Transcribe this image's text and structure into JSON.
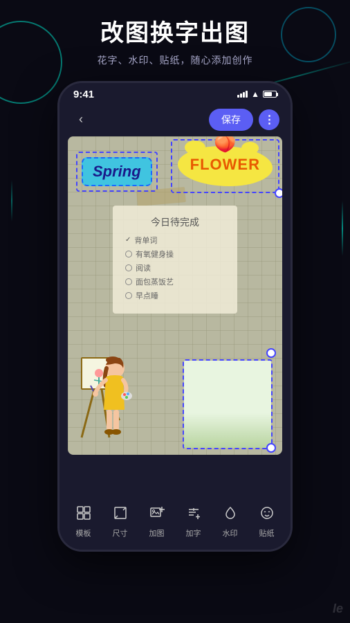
{
  "hero": {
    "title": "改图换字出图",
    "subtitle": "花字、水印、贴纸，随心添加创作"
  },
  "status_bar": {
    "time": "9:41"
  },
  "toolbar": {
    "back_label": "‹",
    "save_label": "保存",
    "more_label": "⋮"
  },
  "stickers": {
    "spring_text": "Spring",
    "flower_text": "FLOWER",
    "peach_emoji": "🍑"
  },
  "todo": {
    "title": "今日待完成",
    "items": [
      "背单词",
      "有氧健身操",
      "阅读",
      "面包蒸饭艺",
      "早点睡"
    ]
  },
  "bottom_tools": [
    {
      "label": "模板",
      "icon": "grid"
    },
    {
      "label": "尺寸",
      "icon": "crop"
    },
    {
      "label": "加图",
      "icon": "image-plus"
    },
    {
      "label": "加字",
      "icon": "text"
    },
    {
      "label": "水印",
      "icon": "drop"
    },
    {
      "label": "贴纸",
      "icon": "sticker"
    }
  ],
  "ic_text": "Ie"
}
